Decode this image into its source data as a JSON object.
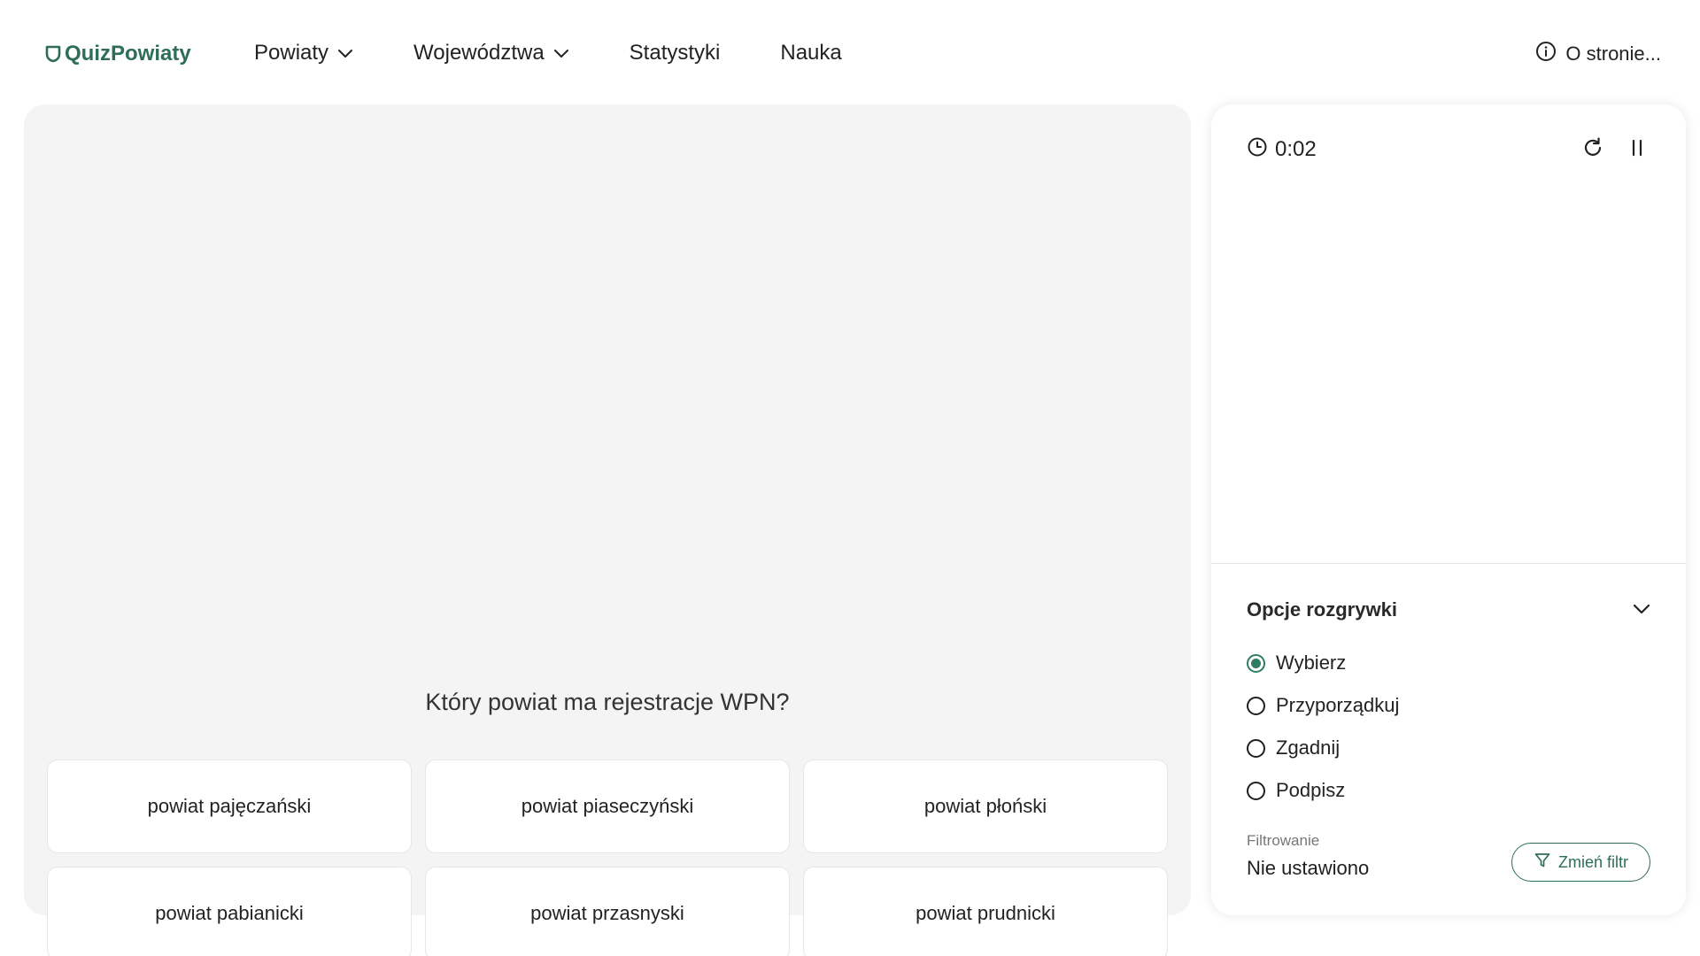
{
  "header": {
    "logo_text": "QuizPowiaty",
    "nav": [
      {
        "label": "Powiaty",
        "has_dropdown": true
      },
      {
        "label": "Województwa",
        "has_dropdown": true
      },
      {
        "label": "Statystyki",
        "has_dropdown": false
      },
      {
        "label": "Nauka",
        "has_dropdown": false
      }
    ],
    "about_label": "O stronie..."
  },
  "quiz": {
    "question": "Który powiat ma rejestracje WPN?",
    "answers": [
      "powiat pajęczański",
      "powiat piaseczyński",
      "powiat płoński",
      "powiat pabianicki",
      "powiat przasnyski",
      "powiat prudnicki"
    ]
  },
  "side": {
    "timer": "0:02",
    "options_title": "Opcje rozgrywki",
    "modes": [
      {
        "label": "Wybierz",
        "checked": true
      },
      {
        "label": "Przyporządkuj",
        "checked": false
      },
      {
        "label": "Zgadnij",
        "checked": false
      },
      {
        "label": "Podpisz",
        "checked": false
      }
    ],
    "filter_label": "Filtrowanie",
    "filter_value": "Nie ustawiono",
    "filter_button": "Zmień filtr"
  },
  "colors": {
    "accent": "#2e6e57",
    "panel_bg": "#f4f4f4",
    "radio_checked": "#2e7d62"
  },
  "icons": {
    "logo": "shield-icon",
    "dropdown": "chevron-down-icon",
    "about": "info-icon",
    "timer": "clock-icon",
    "restart": "restart-icon",
    "pause": "pause-icon",
    "filter": "filter-icon"
  }
}
